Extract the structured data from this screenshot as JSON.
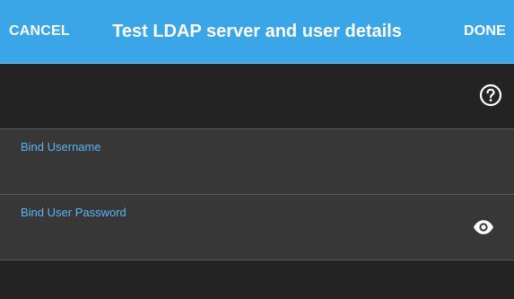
{
  "header": {
    "cancel_label": "CANCEL",
    "title": "Test LDAP server and user details",
    "done_label": "DONE"
  },
  "help": {
    "icon": "help-circle-icon"
  },
  "fields": {
    "username": {
      "label": "Bind Username",
      "value": ""
    },
    "password": {
      "label": "Bind User Password",
      "value": "",
      "toggle_icon": "eye-icon"
    }
  },
  "colors": {
    "header_bg": "#3aa6e8",
    "page_bg": "#232323",
    "field_bg": "#373737",
    "label_accent": "#5ab4f2"
  }
}
